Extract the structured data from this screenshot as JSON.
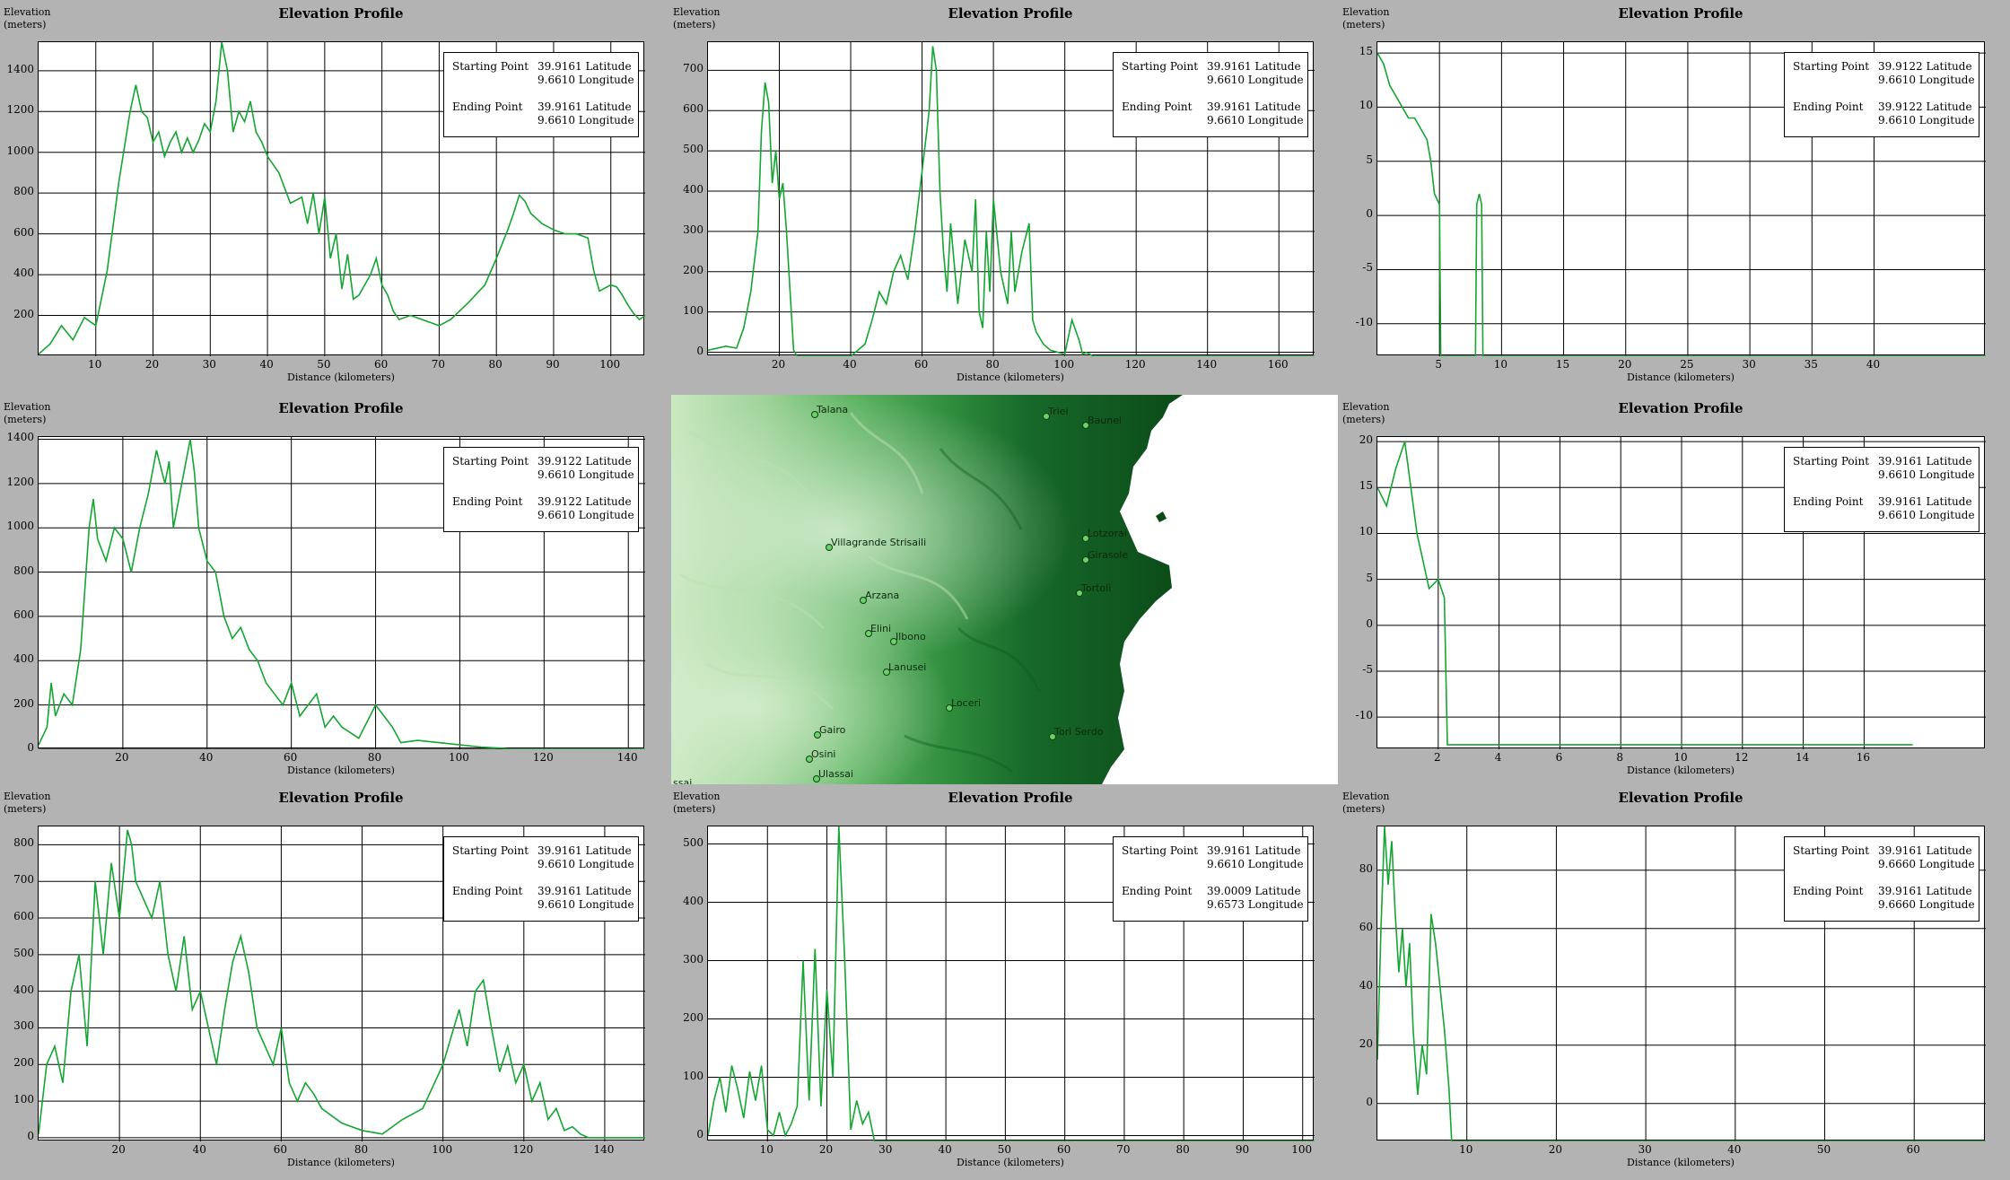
{
  "common": {
    "title": "Elevation Profile",
    "ylabel_line1": "Elevation",
    "ylabel_line2": "(meters)",
    "xlabel": "Distance (kilometers)",
    "start_label": "Starting Point",
    "end_label": "Ending Point",
    "line_color": "#14a532",
    "background_color": "#b3b3b3",
    "plot_background": "#ffffff"
  },
  "chart_data": [
    {
      "type": "line",
      "title": "Elevation Profile",
      "xlabel": "Distance (kilometers)",
      "ylabel": "Elevation (meters)",
      "xlim": [
        0,
        106
      ],
      "ylim": [
        0,
        1540
      ],
      "xticks": [
        10,
        20,
        30,
        40,
        50,
        60,
        70,
        80,
        90,
        100
      ],
      "yticks": [
        200,
        400,
        600,
        800,
        1000,
        1200,
        1400
      ],
      "grid": true,
      "legend": {
        "placement": "top-right",
        "start_lat": "39.9161 Latitude",
        "start_lon": "9.6610 Longitude",
        "end_lat": "39.9161 Latitude",
        "end_lon": "9.6610 Longitude"
      },
      "series": [
        {
          "x": [
            0,
            2,
            4,
            6,
            8,
            10,
            12,
            14,
            16,
            17,
            18,
            19,
            20,
            21,
            22,
            23,
            24,
            25,
            26,
            27,
            28,
            29,
            30,
            31,
            32,
            33,
            34,
            35,
            36,
            37,
            38,
            39,
            40,
            42,
            44,
            46,
            47,
            48,
            49,
            50,
            51,
            52,
            53,
            54,
            55,
            56,
            58,
            59,
            60,
            61,
            62,
            63,
            65,
            68,
            70,
            72,
            75,
            78,
            80,
            82,
            83,
            84,
            85,
            86,
            88,
            90,
            92,
            94,
            96,
            97,
            98,
            100,
            101,
            102,
            103,
            104,
            105,
            106
          ],
          "y": [
            10,
            60,
            150,
            80,
            190,
            150,
            420,
            850,
            1200,
            1330,
            1200,
            1170,
            1050,
            1100,
            980,
            1050,
            1100,
            1000,
            1070,
            1000,
            1060,
            1140,
            1100,
            1250,
            1540,
            1400,
            1100,
            1200,
            1150,
            1250,
            1100,
            1050,
            980,
            900,
            750,
            780,
            650,
            800,
            600,
            780,
            480,
            600,
            330,
            500,
            280,
            300,
            400,
            480,
            350,
            300,
            220,
            180,
            200,
            170,
            150,
            180,
            260,
            350,
            480,
            620,
            700,
            790,
            760,
            700,
            650,
            620,
            600,
            600,
            580,
            420,
            320,
            350,
            340,
            300,
            250,
            210,
            180,
            200
          ]
        }
      ]
    },
    {
      "type": "line",
      "title": "Elevation Profile",
      "xlabel": "Distance (kilometers)",
      "ylabel": "Elevation (meters)",
      "xlim": [
        0,
        170
      ],
      "ylim": [
        -10,
        770
      ],
      "xticks": [
        20,
        40,
        60,
        80,
        100,
        120,
        140,
        160
      ],
      "yticks": [
        0,
        100,
        200,
        300,
        400,
        500,
        600,
        700
      ],
      "grid": true,
      "legend": {
        "placement": "top-right",
        "start_lat": "39.9161 Latitude",
        "start_lon": "9.6610 Longitude",
        "end_lat": "39.9161 Latitude",
        "end_lon": "9.6610 Longitude"
      },
      "series": [
        {
          "x": [
            0,
            5,
            8,
            10,
            12,
            14,
            15,
            16,
            17,
            18,
            19,
            20,
            21,
            22,
            23,
            24,
            25,
            30,
            40,
            44,
            46,
            48,
            50,
            52,
            54,
            56,
            58,
            60,
            62,
            63,
            64,
            65,
            66,
            67,
            68,
            70,
            72,
            74,
            75,
            76,
            77,
            78,
            79,
            80,
            82,
            84,
            85,
            86,
            88,
            90,
            91,
            92,
            94,
            96,
            98,
            100,
            102,
            104,
            105,
            106,
            108,
            110,
            170
          ],
          "y": [
            5,
            15,
            10,
            60,
            150,
            300,
            550,
            670,
            620,
            420,
            500,
            380,
            420,
            300,
            150,
            5,
            -10,
            -10,
            -10,
            20,
            80,
            150,
            120,
            200,
            240,
            180,
            300,
            450,
            600,
            760,
            700,
            400,
            250,
            150,
            320,
            120,
            280,
            200,
            380,
            100,
            60,
            300,
            150,
            380,
            200,
            120,
            300,
            150,
            250,
            320,
            80,
            50,
            20,
            5,
            0,
            -5,
            80,
            30,
            -5,
            0,
            -10,
            -10,
            -10
          ]
        }
      ]
    },
    {
      "type": "line",
      "title": "Elevation Profile",
      "xlabel": "Distance (kilometers)",
      "ylabel": "Elevation (meters)",
      "xlim": [
        0,
        49
      ],
      "ylim": [
        -13,
        16
      ],
      "xticks": [
        5,
        10,
        15,
        20,
        25,
        30,
        35,
        40
      ],
      "yticks": [
        -10,
        -5,
        0,
        5,
        10,
        15
      ],
      "grid": true,
      "legend": {
        "placement": "top-right",
        "start_lat": "39.9122 Latitude",
        "start_lon": "9.6610 Longitude",
        "end_lat": "39.9122 Latitude",
        "end_lon": "9.6610 Longitude"
      },
      "series": [
        {
          "x": [
            0,
            0.5,
            1,
            1.5,
            2,
            2.5,
            3,
            3.5,
            4,
            4.3,
            4.6,
            5,
            5.1,
            5.2,
            7.9,
            8,
            8.2,
            8.4,
            8.5,
            49
          ],
          "y": [
            15,
            14,
            12,
            11,
            10,
            9,
            9,
            8,
            7,
            5,
            2,
            1,
            -13,
            -13,
            -13,
            1,
            2,
            1,
            -13,
            -13
          ]
        }
      ]
    },
    {
      "type": "line",
      "title": "Elevation Profile",
      "xlabel": "Distance (kilometers)",
      "ylabel": "Elevation (meters)",
      "xlim": [
        0,
        144
      ],
      "ylim": [
        0,
        1410
      ],
      "xticks": [
        20,
        40,
        60,
        80,
        100,
        120,
        140
      ],
      "yticks": [
        0,
        200,
        400,
        600,
        800,
        1000,
        1200,
        1400
      ],
      "grid": true,
      "legend": {
        "placement": "top-right",
        "start_lat": "39.9122 Latitude",
        "start_lon": "9.6610 Longitude",
        "end_lat": "39.9122 Latitude",
        "end_lon": "9.6610 Longitude"
      },
      "series": [
        {
          "x": [
            0,
            2,
            3,
            4,
            6,
            8,
            10,
            12,
            13,
            14,
            16,
            18,
            20,
            22,
            24,
            26,
            28,
            30,
            31,
            32,
            34,
            36,
            37,
            38,
            40,
            42,
            44,
            46,
            48,
            50,
            52,
            54,
            56,
            58,
            60,
            62,
            64,
            66,
            68,
            70,
            72,
            76,
            80,
            84,
            86,
            90,
            95,
            100,
            105,
            110,
            112,
            144
          ],
          "y": [
            20,
            100,
            300,
            150,
            250,
            200,
            450,
            1000,
            1130,
            950,
            850,
            1000,
            950,
            800,
            1000,
            1150,
            1350,
            1200,
            1300,
            1000,
            1200,
            1400,
            1250,
            1000,
            850,
            800,
            600,
            500,
            550,
            450,
            400,
            300,
            250,
            200,
            300,
            150,
            200,
            250,
            100,
            150,
            100,
            50,
            200,
            100,
            30,
            40,
            30,
            20,
            10,
            5,
            0,
            0
          ]
        }
      ]
    },
    {
      "type": "line",
      "title": "Elevation Profile",
      "xlabel": "Distance (kilometers)",
      "ylabel": "Elevation (meters)",
      "xlim": [
        0,
        20
      ],
      "ylim": [
        -13.5,
        20.5
      ],
      "xticks": [
        2,
        4,
        6,
        8,
        10,
        12,
        14,
        16
      ],
      "yticks": [
        -10,
        -5,
        0,
        5,
        10,
        15,
        20
      ],
      "grid": true,
      "legend": {
        "placement": "top-right",
        "start_lat": "39.9161 Latitude",
        "start_lon": "9.6610 Longitude",
        "end_lat": "39.9161 Latitude",
        "end_lon": "9.6610 Longitude"
      },
      "series": [
        {
          "x": [
            0,
            0.3,
            0.6,
            0.9,
            1.1,
            1.3,
            1.5,
            1.7,
            2,
            2.2,
            2.3,
            2.35,
            17.6
          ],
          "y": [
            15,
            13,
            17,
            20,
            15,
            10,
            7,
            4,
            5,
            3,
            -13,
            -13,
            -13
          ]
        }
      ]
    },
    {
      "type": "line",
      "title": "Elevation Profile",
      "xlabel": "Distance (kilometers)",
      "ylabel": "Elevation (meters)",
      "xlim": [
        0,
        150
      ],
      "ylim": [
        -10,
        850
      ],
      "xticks": [
        20,
        40,
        60,
        80,
        100,
        120,
        140
      ],
      "yticks": [
        0,
        100,
        200,
        300,
        400,
        500,
        600,
        700,
        800
      ],
      "grid": true,
      "legend": {
        "placement": "top-right",
        "start_lat": "39.9161 Latitude",
        "start_lon": "9.6610 Longitude",
        "end_lat": "39.9161 Latitude",
        "end_lon": "9.6610 Longitude"
      },
      "series": [
        {
          "x": [
            0,
            2,
            4,
            6,
            8,
            10,
            12,
            14,
            16,
            18,
            20,
            22,
            23,
            24,
            26,
            28,
            30,
            32,
            34,
            36,
            38,
            40,
            42,
            44,
            46,
            48,
            50,
            52,
            54,
            56,
            58,
            60,
            62,
            64,
            66,
            68,
            70,
            75,
            80,
            85,
            90,
            95,
            100,
            104,
            106,
            108,
            110,
            112,
            114,
            116,
            118,
            120,
            122,
            124,
            126,
            128,
            130,
            132,
            134,
            136,
            150
          ],
          "y": [
            10,
            200,
            250,
            150,
            400,
            500,
            250,
            700,
            500,
            750,
            600,
            840,
            800,
            700,
            650,
            600,
            700,
            500,
            400,
            550,
            350,
            400,
            300,
            200,
            350,
            480,
            550,
            450,
            300,
            250,
            200,
            300,
            150,
            100,
            150,
            120,
            80,
            40,
            20,
            10,
            50,
            80,
            200,
            350,
            250,
            400,
            430,
            300,
            180,
            250,
            150,
            200,
            100,
            150,
            50,
            80,
            20,
            30,
            10,
            0,
            0
          ]
        }
      ]
    },
    {
      "type": "line",
      "title": "Elevation Profile",
      "xlabel": "Distance (kilometers)",
      "ylabel": "Elevation (meters)",
      "xlim": [
        0,
        102
      ],
      "ylim": [
        -10,
        530
      ],
      "xticks": [
        10,
        20,
        30,
        40,
        50,
        60,
        70,
        80,
        90,
        100
      ],
      "yticks": [
        0,
        100,
        200,
        300,
        400,
        500
      ],
      "grid": true,
      "legend": {
        "placement": "top-right",
        "start_lat": "39.9161 Latitude",
        "start_lon": "9.6610 Longitude",
        "end_lat": "39.0009 Latitude",
        "end_lon": "9.6573 Longitude"
      },
      "series": [
        {
          "x": [
            0,
            1,
            2,
            3,
            4,
            5,
            6,
            7,
            8,
            9,
            10,
            11,
            12,
            13,
            14,
            15,
            16,
            17,
            18,
            19,
            20,
            21,
            22,
            23,
            24,
            25,
            26,
            27,
            28,
            102
          ],
          "y": [
            0,
            60,
            100,
            40,
            120,
            80,
            30,
            110,
            60,
            120,
            10,
            0,
            40,
            0,
            20,
            50,
            300,
            60,
            320,
            50,
            250,
            100,
            530,
            300,
            10,
            60,
            20,
            40,
            -10,
            -10
          ]
        }
      ]
    },
    {
      "type": "line",
      "title": "Elevation Profile",
      "xlabel": "Distance (kilometers)",
      "ylabel": "Elevation (meters)",
      "xlim": [
        0,
        68
      ],
      "ylim": [
        -13,
        95
      ],
      "xticks": [
        10,
        20,
        30,
        40,
        50,
        60
      ],
      "yticks": [
        0,
        20,
        40,
        60,
        80
      ],
      "grid": true,
      "legend": {
        "placement": "top-right",
        "start_lat": "39.9161 Latitude",
        "start_lon": "9.6660 Longitude",
        "end_lat": "39.9161 Latitude",
        "end_lon": "9.6660 Longitude"
      },
      "series": [
        {
          "x": [
            0,
            0.4,
            0.8,
            1.2,
            1.6,
            2,
            2.4,
            2.8,
            3.2,
            3.6,
            4,
            4.5,
            5,
            5.5,
            6,
            6.5,
            7,
            7.5,
            8,
            8.3,
            68
          ],
          "y": [
            15,
            60,
            95,
            75,
            90,
            65,
            45,
            60,
            40,
            55,
            25,
            3,
            20,
            10,
            65,
            55,
            40,
            25,
            5,
            -13,
            -13
          ]
        }
      ]
    }
  ],
  "map": {
    "towns": [
      {
        "name": "Talana"
      },
      {
        "name": "Triei"
      },
      {
        "name": "Baunei"
      },
      {
        "name": "Villagrande Strisaili"
      },
      {
        "name": "Lotzorai"
      },
      {
        "name": "Girasole"
      },
      {
        "name": "Tortolì"
      },
      {
        "name": "Arzana"
      },
      {
        "name": "Elini"
      },
      {
        "name": "Ilbono"
      },
      {
        "name": "Lanusei"
      },
      {
        "name": "Loceri"
      },
      {
        "name": "Gairo"
      },
      {
        "name": "Torì Serdo"
      },
      {
        "name": "Osini"
      },
      {
        "name": "Ulassai"
      },
      {
        "name": "ssai"
      }
    ],
    "dark_green": "#0e5a1e",
    "light_green": "#a8d9a8"
  }
}
